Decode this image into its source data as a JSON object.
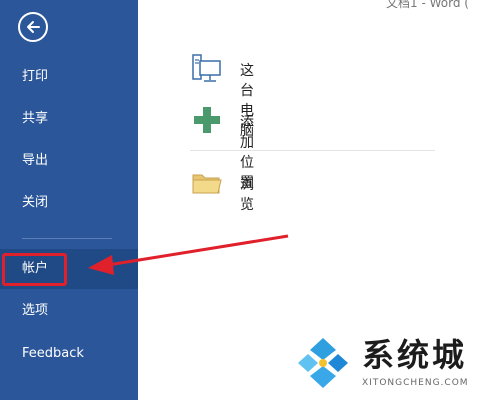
{
  "window": {
    "title_fragment": "文档1 - Word ("
  },
  "sidebar": {
    "items": [
      {
        "label": "打印"
      },
      {
        "label": "共享"
      },
      {
        "label": "导出"
      },
      {
        "label": "关闭"
      },
      {
        "label": "帐户"
      },
      {
        "label": "选项"
      },
      {
        "label": "Feedback"
      }
    ],
    "active_index": 4
  },
  "locations": [
    {
      "label": "这台电脑",
      "icon": "computer-icon"
    },
    {
      "label": "添加位置",
      "icon": "plus-icon"
    },
    {
      "label": "浏览",
      "icon": "folder-icon"
    }
  ],
  "watermark": {
    "title": "系统城",
    "url": "XITONGCHENG.COM"
  },
  "colors": {
    "sidebar": "#2b579a",
    "highlight": "#e0202a",
    "plus": "#4a9a6e"
  }
}
